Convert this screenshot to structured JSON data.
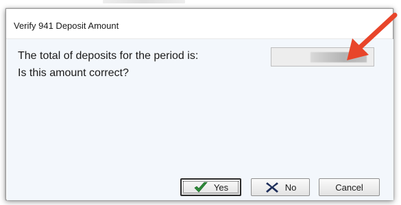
{
  "window": {
    "title": "Verify 941 Deposit Amount"
  },
  "message": {
    "prompt": "The total of deposits for the period  is:",
    "question": "Is this amount correct?"
  },
  "amount_field": {
    "value": ""
  },
  "buttons": {
    "yes_label": "Yes",
    "no_label": "No",
    "cancel_label": "Cancel"
  },
  "icons": {
    "yes": "checkmark-icon",
    "no": "x-icon",
    "arrow": "arrow-annotation"
  },
  "colors": {
    "arrow": "#e8452a",
    "checkmark": "#2e8b3a",
    "x_mark": "#1e2e5a",
    "content_bg": "#f3f7fc"
  }
}
